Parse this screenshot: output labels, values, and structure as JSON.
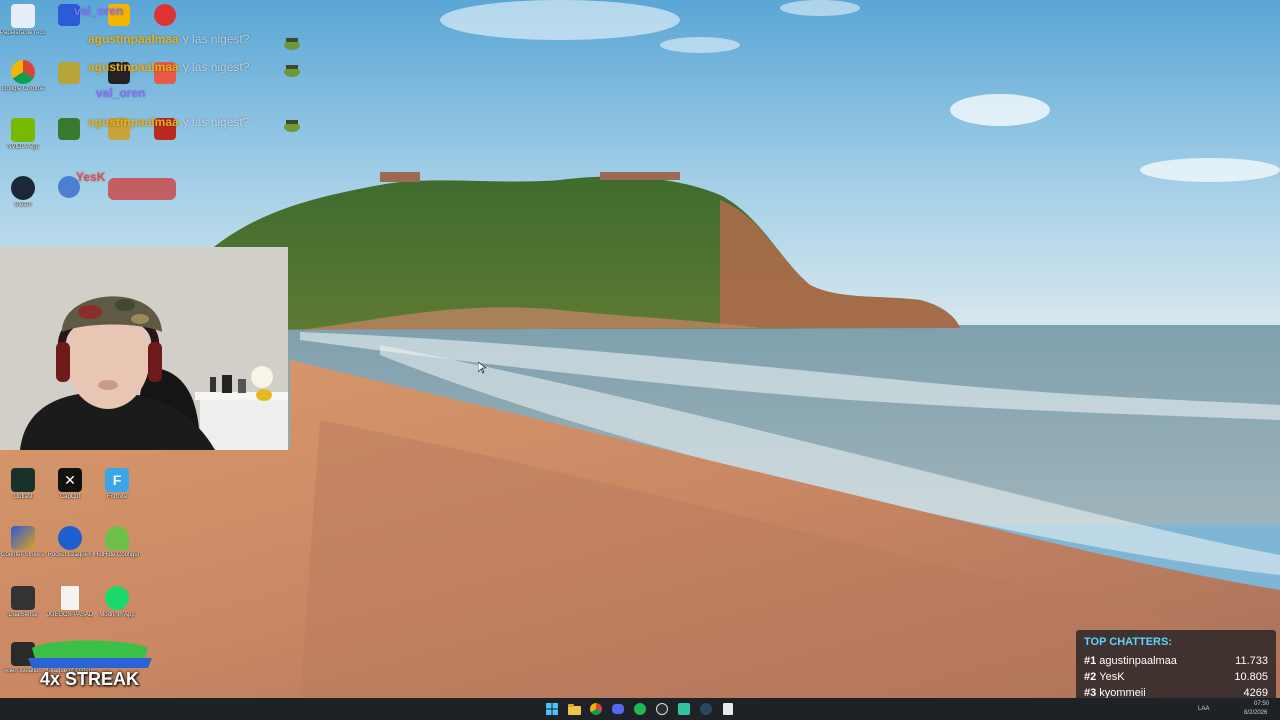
{
  "desktop_icons": {
    "col1": [
      {
        "label": "Papelera de reciclaje",
        "icon": "recycle-bin-icon",
        "color": "#e6eef7"
      },
      {
        "label": "Google Chrome",
        "icon": "chrome-icon",
        "color": "#dd4b39"
      },
      {
        "label": "NVIDIA App",
        "icon": "nvidia-icon",
        "color": "#2d3a1b"
      },
      {
        "label": "Steam",
        "icon": "steam-icon",
        "color": "#1b2838"
      },
      {
        "label": "Outlast",
        "icon": "outlast-icon",
        "color": "#17322a"
      },
      {
        "label": "Counter-Strike 2",
        "icon": "counter-strike-icon",
        "color": "#e0a020"
      },
      {
        "label": "DualSense",
        "icon": "dualsense-icon",
        "color": "#333333"
      },
      {
        "label": "Alien Isolation",
        "icon": "alien-icon",
        "color": "#2a2a2a"
      }
    ],
    "col2": [
      {
        "label": "CapCut",
        "icon": "capcut-icon",
        "color": "#111111"
      },
      {
        "label": "Rocket League®",
        "icon": "rocket-league-icon",
        "color": "#1d5fcc"
      },
      {
        "label": "JUEGOS PASADOS E...",
        "icon": "document-icon",
        "color": "#f3f3f3"
      },
      {
        "label": "League of Legends",
        "icon": "league-icon",
        "color": "#c9a24c"
      }
    ],
    "col3": [
      {
        "label": "Fortnite",
        "icon": "fortnite-icon",
        "color": "#3aa6e8"
      },
      {
        "label": "HidHide Configurati...",
        "icon": "hidhide-icon",
        "color": "#6cc04a"
      },
      {
        "label": "Modrinth App",
        "icon": "modrinth-icon",
        "color": "#1bd96a"
      }
    ]
  },
  "chat_overlay": {
    "lines": [
      {
        "user": "agustinpaalmaa",
        "msg": "y las nigest?"
      },
      {
        "user": "agustinpaalmaa",
        "msg": "y las nigest?"
      },
      {
        "user": "agustinpaalmaa",
        "msg": "y las nigest?"
      }
    ],
    "floating_names": [
      "val_oren",
      "val_oren",
      "YesK"
    ]
  },
  "streak": {
    "label": "4x STREAK"
  },
  "top_chatters": {
    "title": "TOP CHATTERS:",
    "rows": [
      {
        "rank": "#1",
        "name": "agustinpaalmaa",
        "value": "11.733"
      },
      {
        "rank": "#2",
        "name": "YesK",
        "value": "10.805"
      },
      {
        "rank": "#3",
        "name": "kyommeii",
        "value": "4269"
      }
    ]
  },
  "taskbar": {
    "apps": [
      "windows-start-icon",
      "file-explorer-icon",
      "chrome-icon",
      "discord-icon",
      "spotify-icon",
      "obs-icon",
      "streamlabs-icon",
      "steam-icon",
      "notepad-icon"
    ],
    "tray": {
      "lang": "LAA",
      "time": "07:50",
      "date": "8/2/2026"
    }
  },
  "colors": {
    "accent_chat_user": "#e6b020",
    "chatters_title": "#5fd4ff",
    "taskbar": "#1e2126"
  }
}
